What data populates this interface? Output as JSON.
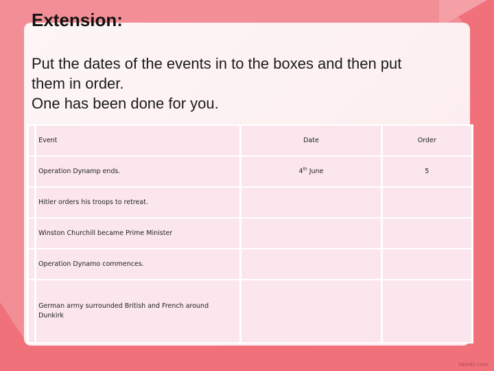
{
  "slide": {
    "title": "Extension:",
    "instructions": [
      "Put the dates of the events in to the boxes and then put",
      "them in order.",
      "One has been done for you."
    ],
    "watermark": "twinkl.com",
    "colors": {
      "background": "#f28e96",
      "accent_dark": "#f1717a",
      "card": "#fdf5f6",
      "cell": "#fae6ec"
    }
  },
  "table": {
    "headers": {
      "event": "Event",
      "date": "Date",
      "order": "Order"
    },
    "rows": [
      {
        "event": "Operation Dynamp ends.",
        "date_day": "4",
        "date_suffix": "th",
        "date_month": " June",
        "order": "5"
      },
      {
        "event": "Hitler orders his troops to retreat.",
        "date_day": "",
        "date_suffix": "",
        "date_month": "",
        "order": ""
      },
      {
        "event": "Winston Churchill became Prime Minister",
        "date_day": "",
        "date_suffix": "",
        "date_month": "",
        "order": ""
      },
      {
        "event": "Operation Dynamo commences.",
        "date_day": "",
        "date_suffix": "",
        "date_month": "",
        "order": ""
      },
      {
        "event": "German army surrounded British and French around Dunkirk",
        "date_day": "",
        "date_suffix": "",
        "date_month": "",
        "order": ""
      }
    ]
  }
}
